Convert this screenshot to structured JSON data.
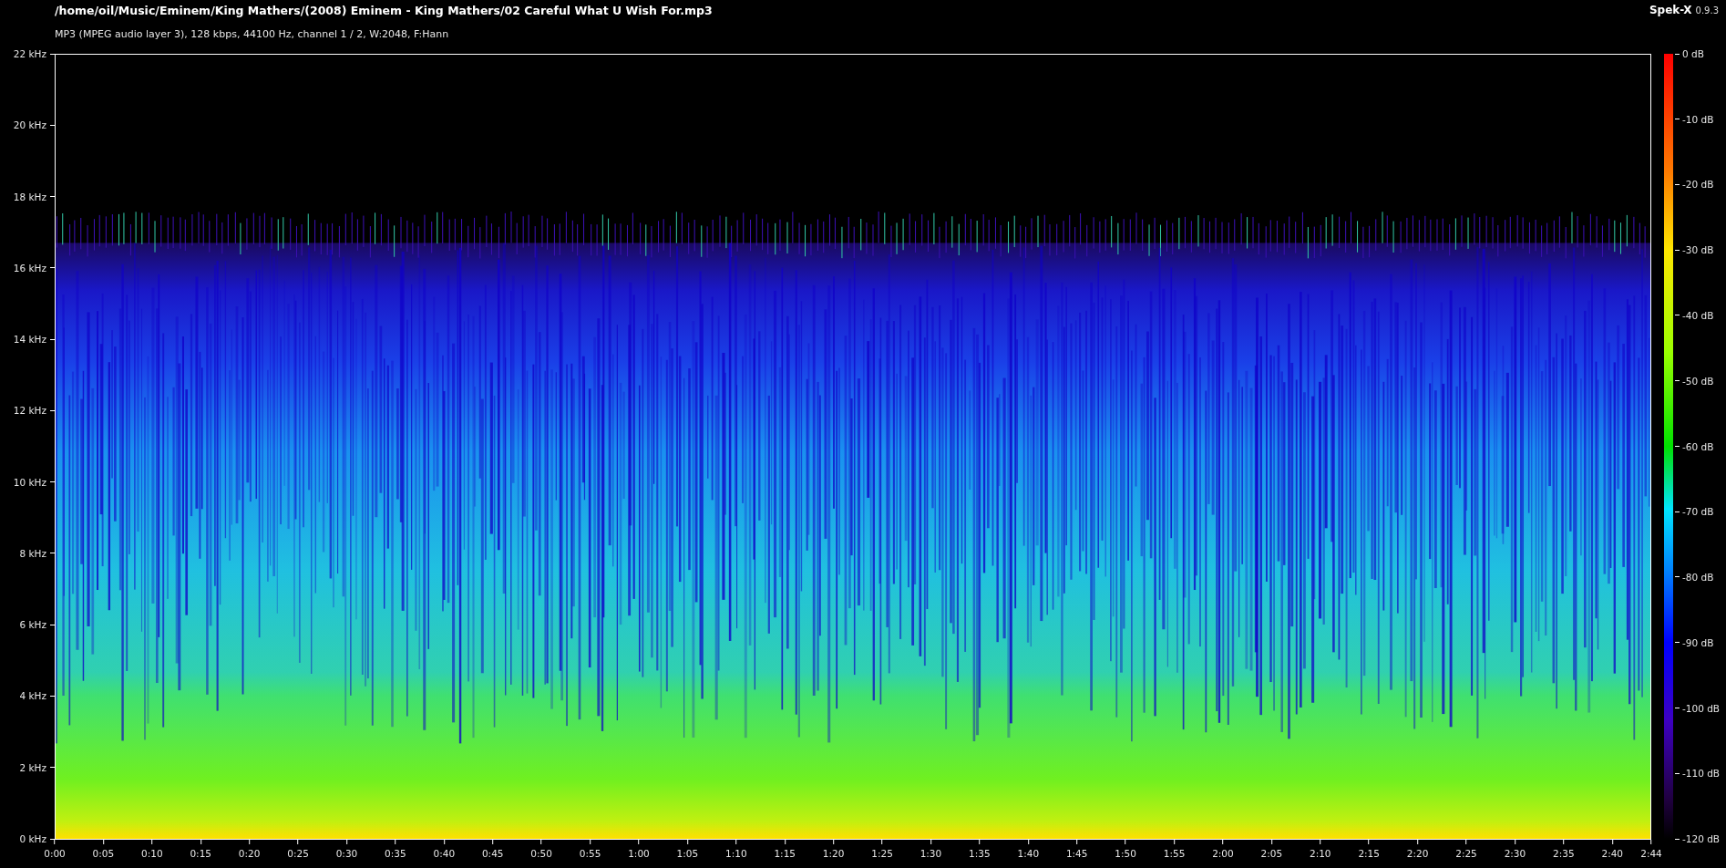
{
  "header": {
    "title": "/home/oil/Music/Eminem/King Mathers/(2008) Eminem - King Mathers/02 Careful What U Wish For.mp3",
    "info": "MP3 (MPEG audio layer 3), 128 kbps, 44100 Hz, channel 1 / 2, W:2048, F:Hann",
    "app_name": "Spek-X",
    "app_version": "0.9.3"
  },
  "frequency_axis": [
    "22 kHz",
    "20 kHz",
    "18 kHz",
    "16 kHz",
    "14 kHz",
    "12 kHz",
    "10 kHz",
    "8 kHz",
    "6 kHz",
    "4 kHz",
    "2 kHz",
    "0 kHz"
  ],
  "time_axis": [
    "0:00",
    "0:05",
    "0:10",
    "0:15",
    "0:20",
    "0:25",
    "0:30",
    "0:35",
    "0:40",
    "0:45",
    "0:50",
    "0:55",
    "1:00",
    "1:05",
    "1:10",
    "1:15",
    "1:20",
    "1:25",
    "1:30",
    "1:35",
    "1:40",
    "1:45",
    "1:50",
    "1:55",
    "2:00",
    "2:05",
    "2:10",
    "2:15",
    "2:20",
    "2:25",
    "2:30",
    "2:35",
    "2:40",
    "2:44"
  ],
  "db_scale": [
    "0 dB",
    "-10 dB",
    "-20 dB",
    "-30 dB",
    "-40 dB",
    "-50 dB",
    "-60 dB",
    "-70 dB",
    "-80 dB",
    "-90 dB",
    "-100 dB",
    "-110 dB",
    "-120 dB"
  ]
}
